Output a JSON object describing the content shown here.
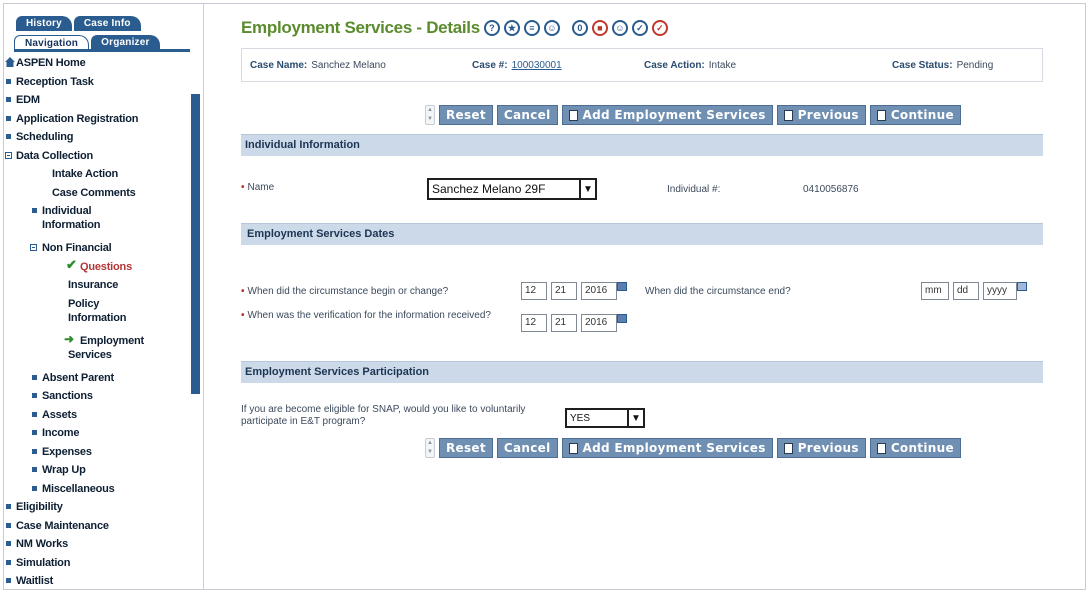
{
  "sidebar": {
    "tabs_top": [
      "History",
      "Case Info"
    ],
    "tabs_bottom": [
      "Navigation",
      "Organizer"
    ],
    "items": [
      {
        "label": "ASPEN Home"
      },
      {
        "label": "Reception Task"
      },
      {
        "label": "EDM"
      },
      {
        "label": "Application Registration"
      },
      {
        "label": "Scheduling"
      },
      {
        "label": "Data Collection"
      },
      {
        "label": "Intake Action"
      },
      {
        "label": "Case Comments"
      },
      {
        "label": "Individual Information"
      },
      {
        "label": "Non Financial"
      },
      {
        "label": "Questions"
      },
      {
        "label": "Insurance"
      },
      {
        "label": "Policy Information"
      },
      {
        "label": "Employment Services"
      },
      {
        "label": "Absent Parent"
      },
      {
        "label": "Sanctions"
      },
      {
        "label": "Assets"
      },
      {
        "label": "Income"
      },
      {
        "label": "Expenses"
      },
      {
        "label": "Wrap Up"
      },
      {
        "label": "Miscellaneous"
      },
      {
        "label": "Eligibility"
      },
      {
        "label": "Case Maintenance"
      },
      {
        "label": "NM Works"
      },
      {
        "label": "Simulation"
      },
      {
        "label": "Waitlist"
      }
    ]
  },
  "header": {
    "title": "Employment Services - Details",
    "icons": [
      "?",
      "★",
      "≡",
      "☺",
      "0",
      "■",
      "☺",
      "✓",
      "✓"
    ]
  },
  "case": {
    "name_label": "Case Name:",
    "name_value": "Sanchez Melano",
    "number_label": "Case #:",
    "number_value": "100030001",
    "action_label": "Case Action:",
    "action_value": "Intake",
    "status_label": "Case Status:",
    "status_value": "Pending"
  },
  "buttons": {
    "reset": "Reset",
    "cancel": "Cancel",
    "add": "Add Employment Services",
    "previous": "Previous",
    "continue": "Continue"
  },
  "individual_info": {
    "section_title": "Individual Information",
    "name_label": "Name",
    "name_value": "Sanchez Melano 29F",
    "indiv_label": "Individual #:",
    "indiv_value": "0410056876"
  },
  "dates": {
    "section_title": "Employment Services Dates",
    "begin_label": "When did the circumstance begin or change?",
    "begin": {
      "mm": "12",
      "dd": "21",
      "yyyy": "2016"
    },
    "end_label": "When did the circumstance end?",
    "end": {
      "mm": "mm",
      "dd": "dd",
      "yyyy": "yyyy"
    },
    "verif_label": "When was the verification for the information received?",
    "verif": {
      "mm": "12",
      "dd": "21",
      "yyyy": "2016"
    }
  },
  "participation": {
    "section_title": "Employment Services Participation",
    "question": "If you are become eligible for SNAP, would you like to voluntarily participate in E&T program?",
    "answer": "YES"
  }
}
